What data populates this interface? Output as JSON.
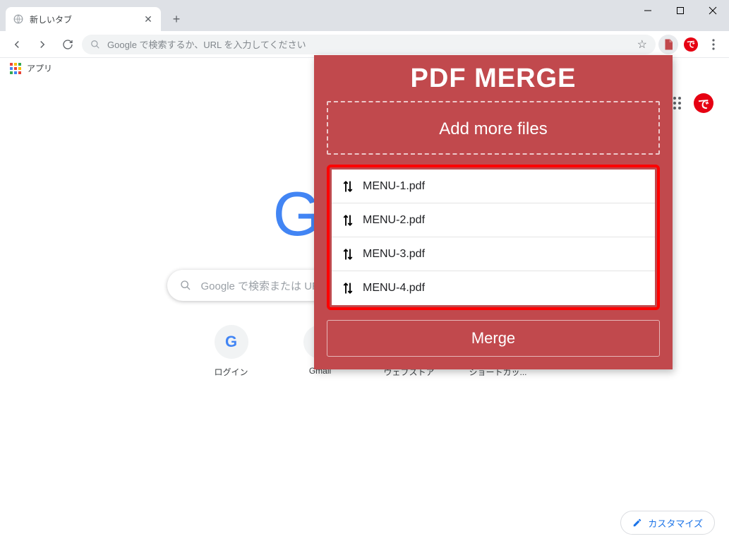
{
  "titlebar": {
    "tab_title": "新しいタブ"
  },
  "toolbar": {
    "omnibox_placeholder": "Google で検索するか、URL を入力してください"
  },
  "bookmarks": {
    "apps_label": "アプリ"
  },
  "ntp": {
    "search_placeholder": "Google で検索または URL を入力",
    "shortcuts": [
      {
        "label": "ログイン"
      },
      {
        "label": "Gmail"
      },
      {
        "label": "ウェブストア"
      },
      {
        "label": "ショートカッ..."
      }
    ],
    "customize_label": "カスタマイズ"
  },
  "extension": {
    "title": "PDF MERGE",
    "add_label": "Add more files",
    "files": [
      "MENU-1.pdf",
      "MENU-2.pdf",
      "MENU-3.pdf",
      "MENU-4.pdf"
    ],
    "merge_label": "Merge"
  }
}
